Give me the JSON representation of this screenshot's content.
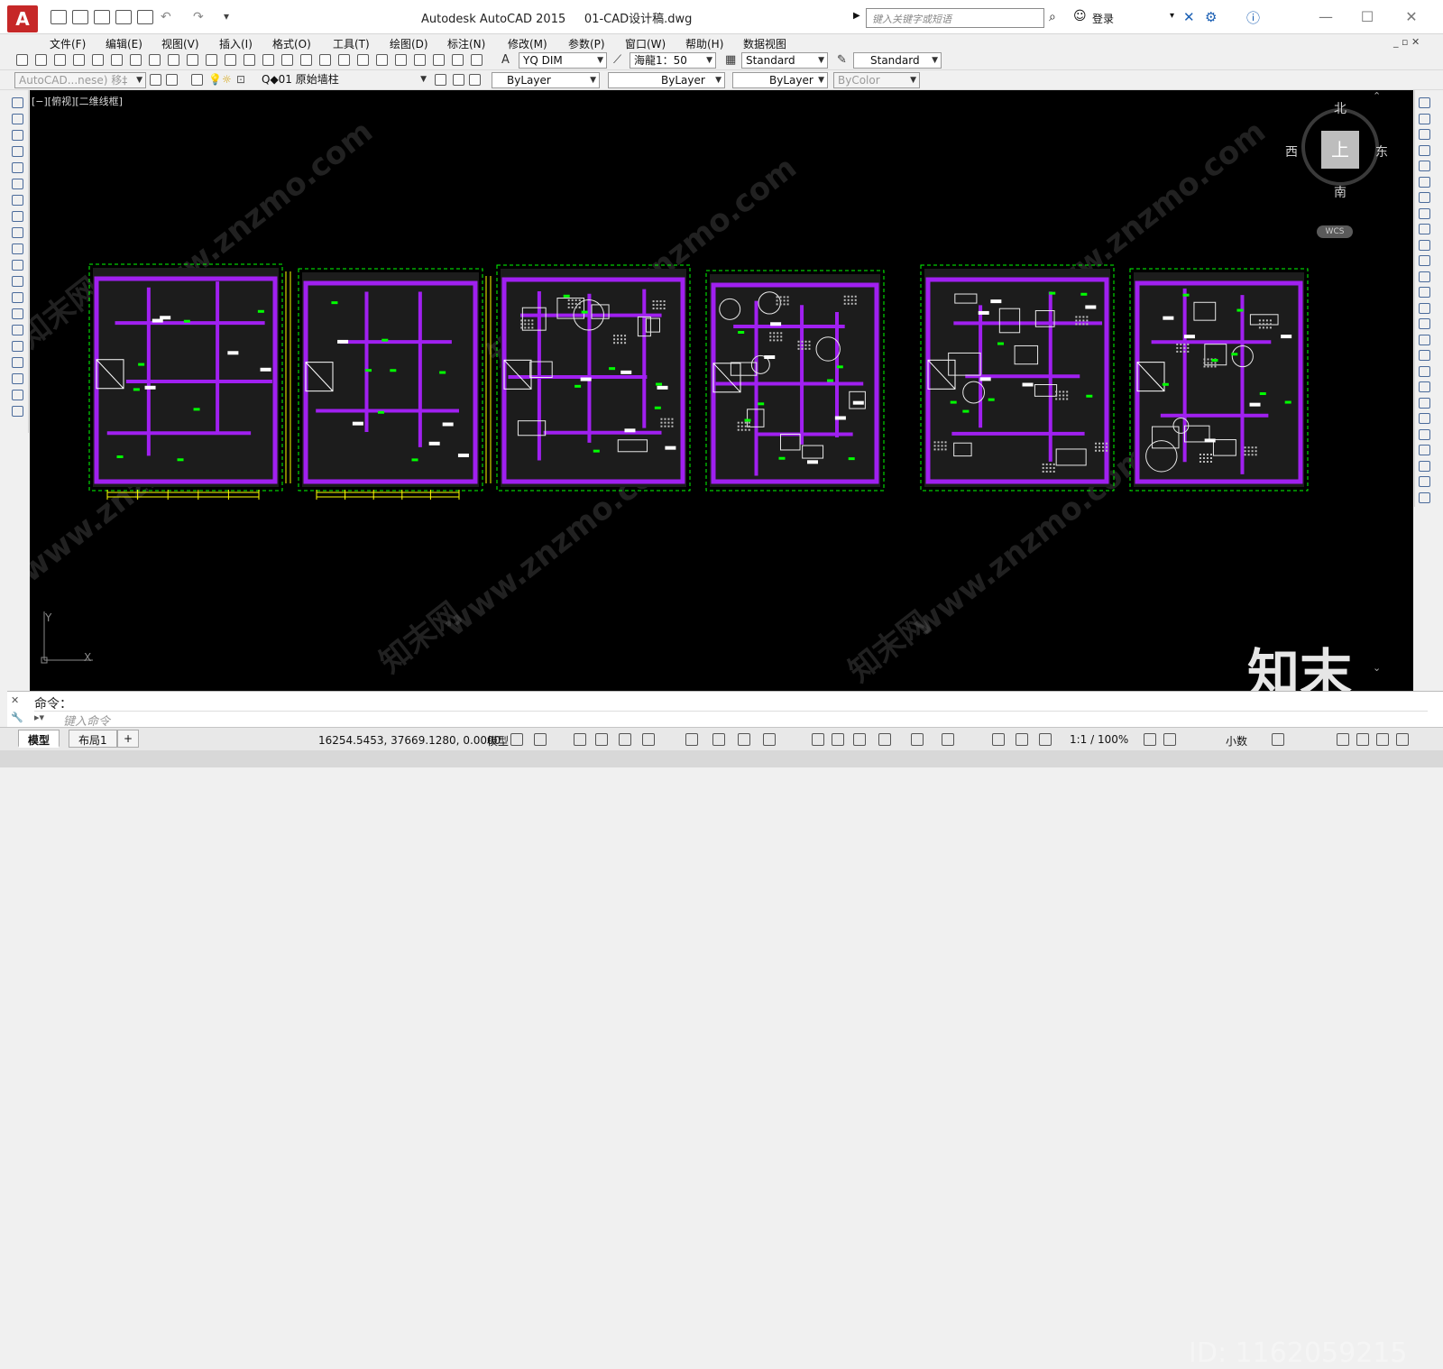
{
  "window": {
    "app_title": "Autodesk AutoCAD 2015",
    "file_name": "01-CAD设计稿.dwg",
    "search_placeholder": "键入关键字或短语",
    "login_label": "登录",
    "app_button_glyph": "A"
  },
  "menu": [
    "文件(F)",
    "编辑(E)",
    "视图(V)",
    "插入(I)",
    "格式(O)",
    "工具(T)",
    "绘图(D)",
    "标注(N)",
    "修改(M)",
    "参数(P)",
    "窗口(W)",
    "帮助(H)",
    "数据视图"
  ],
  "toolbar": {
    "dim_style": "YQ DIM",
    "scale": "海龍1：50",
    "text_style": "Standard",
    "table_style": "Standard",
    "workspace": "AutoCAD...nese) 移‡",
    "layer": "Q◆01 原始墙柱",
    "color": "ByLayer",
    "linetype": "ByLayer",
    "lineweight": "ByLayer",
    "plotstyle": "ByColor"
  },
  "canvas": {
    "viewport_label": "[−][俯视][二维线框]",
    "background": "#000000",
    "wall_color": "#a020f0",
    "dim_color": "#ffff00",
    "tag_color": "#00ff00",
    "watermark": "www.znzmo.com",
    "watermark_cn": "知末网",
    "ucs_y": "Y",
    "ucs_x": "X"
  },
  "viewcube": {
    "north": "北",
    "south": "南",
    "west": "西",
    "east": "东",
    "face": "上",
    "wcs": "WCS"
  },
  "overlay": {
    "logo": "知末",
    "id": "ID: 1162059215"
  },
  "command": {
    "label": "命令：",
    "placeholder": "键入命令"
  },
  "status": {
    "tabs": [
      "模型",
      "布局1"
    ],
    "coords": "16254.5453, 37669.1280, 0.0000",
    "space": "模型",
    "scale": "1:1 / 100%",
    "units": "小数"
  }
}
